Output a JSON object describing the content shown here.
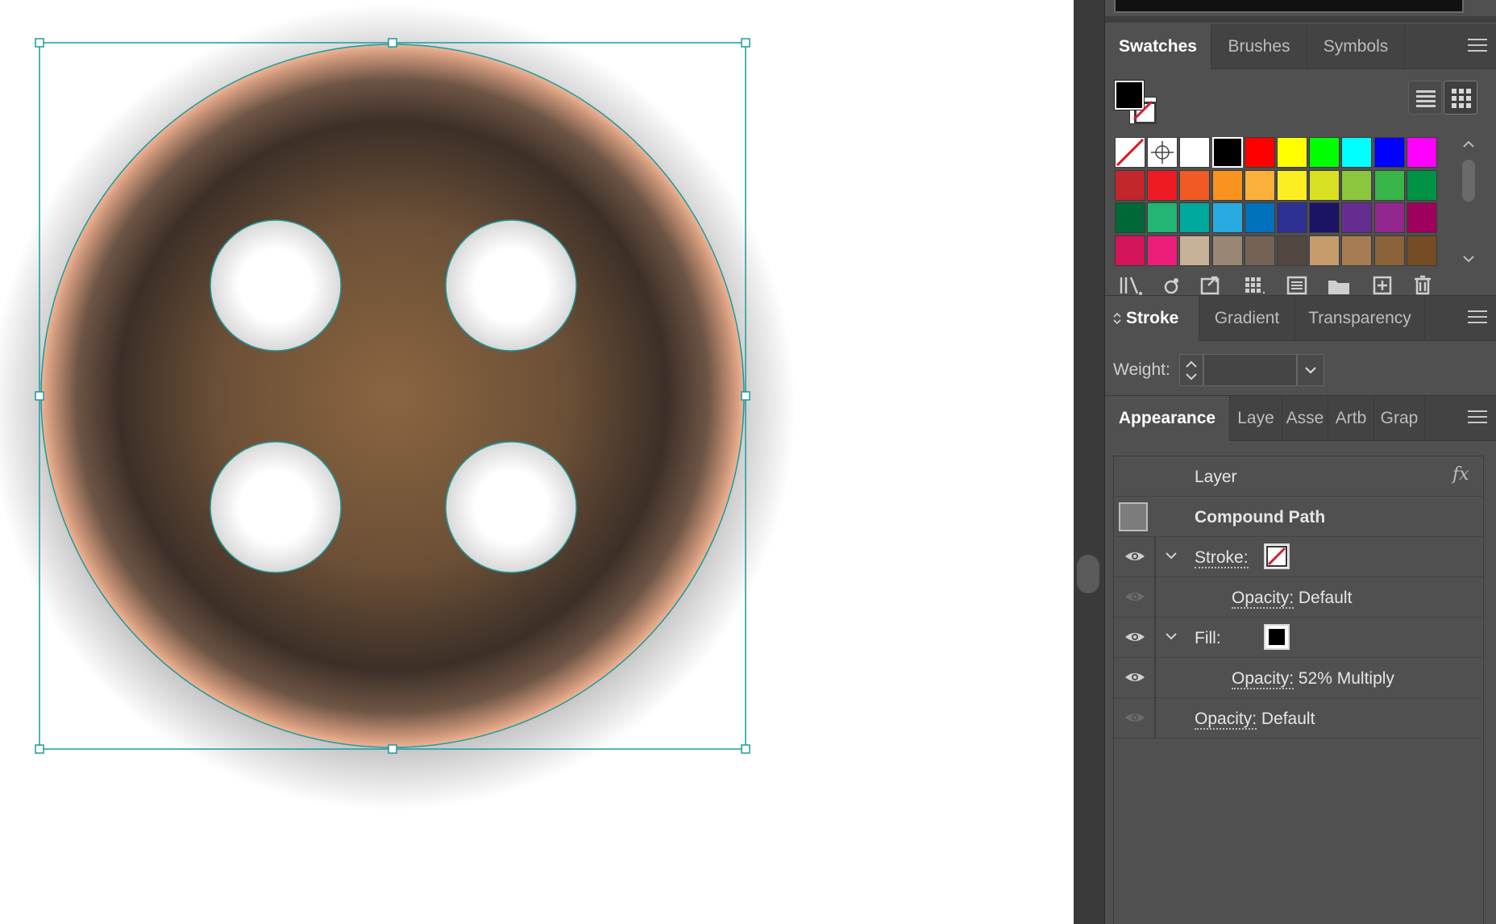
{
  "swatches_panel": {
    "tabs": [
      "Swatches",
      "Brushes",
      "Symbols"
    ],
    "active_tab": "Swatches",
    "colors": [
      [
        "none",
        "registration",
        "#ffffff",
        "#000000",
        "#ff0000",
        "#ffff00",
        "#00ff00",
        "#00ffff",
        "#0000ff",
        "#ff00ff"
      ],
      [
        "#c1272d",
        "#ed1c24",
        "#f15a24",
        "#f7931e",
        "#fbb03b",
        "#fcee21",
        "#d9e021",
        "#8cc63f",
        "#39b54a",
        "#009245"
      ],
      [
        "#006837",
        "#22b573",
        "#00a99d",
        "#29abe2",
        "#0071bc",
        "#2e3192",
        "#1b1464",
        "#662d91",
        "#93278f",
        "#9e005d"
      ],
      [
        "#d4145a",
        "#ed1e79",
        "#c7b299",
        "#998675",
        "#736357",
        "#534741",
        "#c69c6d",
        "#a67c52",
        "#8c6239",
        "#754c24"
      ]
    ],
    "tool_icons": [
      "swatch-libraries-icon",
      "color-group-icon",
      "place-swatches-icon",
      "kind-menu-icon",
      "swatch-options-icon",
      "new-color-group-icon",
      "new-swatch-icon",
      "delete-swatch-icon"
    ]
  },
  "stroke_panel": {
    "tabs": [
      "Stroke",
      "Gradient",
      "Transparency"
    ],
    "active_tab": "Stroke",
    "weight_label": "Weight:",
    "weight_value": ""
  },
  "appearance_panel": {
    "tabs": [
      "Appearance",
      "Laye",
      "Asse",
      "Artb",
      "Grap"
    ],
    "active_tab": "Appearance",
    "fx_label": "fx",
    "header_title": "Layer",
    "object_title": "Compound Path",
    "stroke_label": "Stroke:",
    "stroke_opacity_label": "Opacity:",
    "stroke_opacity_value": "Default",
    "fill_label": "Fill:",
    "fill_opacity_label": "Opacity:",
    "fill_opacity_value": "52% Multiply",
    "object_opacity_label": "Opacity:",
    "object_opacity_value": "Default"
  },
  "colors": {
    "selection": "#1c9a9e",
    "panel_bg": "#505050",
    "button_mid": "#8a6541",
    "button_dark": "#3c2f28",
    "button_rim": "#f0b493"
  }
}
